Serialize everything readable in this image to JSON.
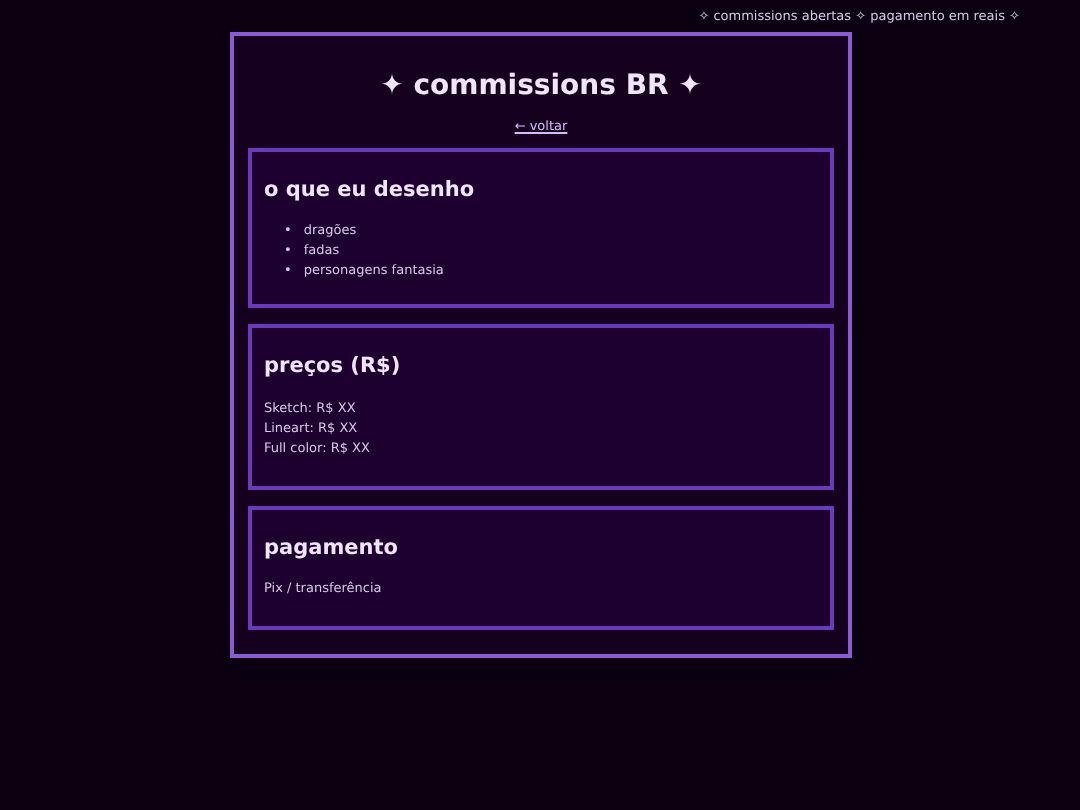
{
  "ticker": "✧ commissions abertas ✧ pagamento em reais ✧",
  "title": "✦ commissions BR ✦",
  "back_link": "← voltar",
  "sections": [
    {
      "heading": "o que eu desenho",
      "kind": "bullets",
      "marker": "•",
      "items": [
        "dragões",
        "fadas",
        "personagens fantasia"
      ]
    },
    {
      "heading": "preços (R$)",
      "kind": "lines",
      "items": [
        "Sketch: R$ XX",
        "Lineart: R$ XX",
        "Full color: R$ XX"
      ]
    },
    {
      "heading": "pagamento",
      "kind": "lines",
      "items": [
        "Pix / transferência"
      ]
    }
  ]
}
